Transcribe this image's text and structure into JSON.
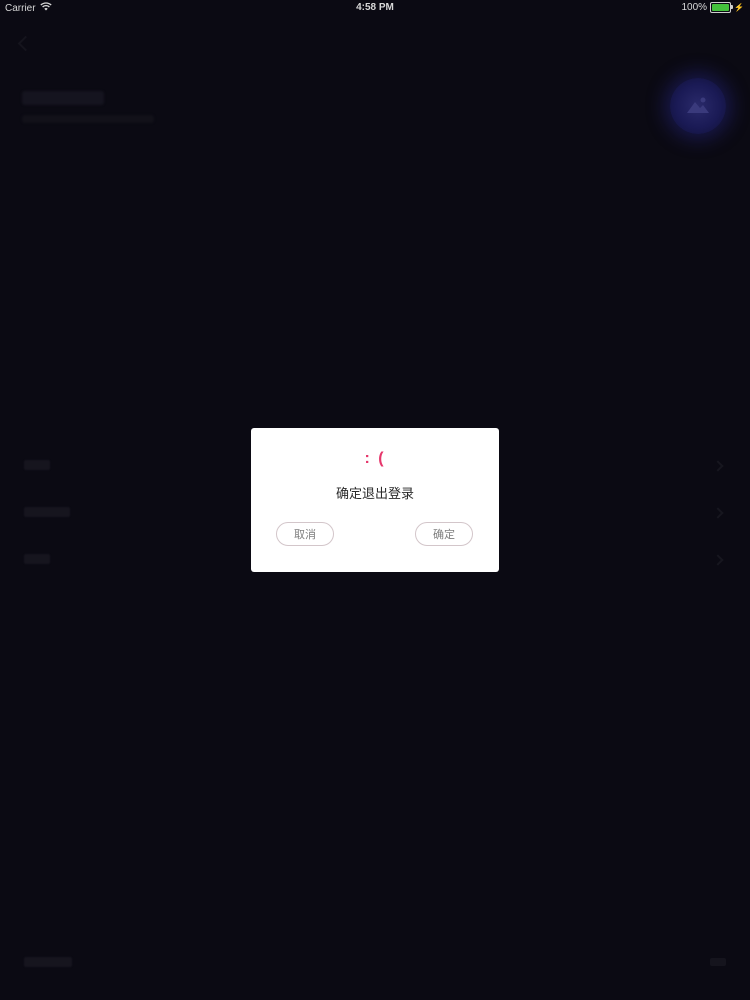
{
  "status_bar": {
    "carrier": "Carrier",
    "time": "4:58 PM",
    "battery": "100%",
    "battery_color": "#44c13c"
  },
  "dialog": {
    "emoticon": ": (",
    "message": "确定退出登录",
    "cancel_label": "取消",
    "confirm_label": "确定",
    "accent_color": "#e6366b"
  },
  "icons": {
    "wifi": "wifi-icon",
    "battery": "battery-icon",
    "charging": "charging-icon",
    "back": "back-arrow-icon",
    "avatar": "avatar-icon",
    "chevron": "chevron-right-icon"
  }
}
